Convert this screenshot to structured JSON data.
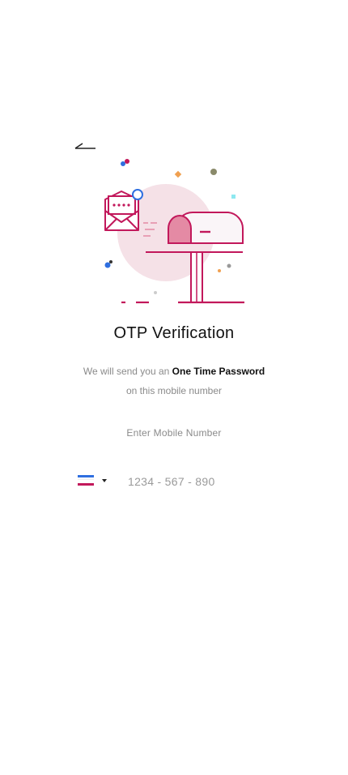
{
  "header": {
    "back_icon": "arrow-left-icon"
  },
  "illustration": {
    "icon": "mailbox-envelope-illustration",
    "colors": {
      "primary": "#c2185b",
      "circle": "#f5e1e7",
      "pink_fill": "#e48aa4"
    }
  },
  "title": "OTP Verification",
  "subtitle": {
    "prefix": "We will send you an ",
    "emphasis": "One Time Password",
    "line2": "on this mobile number"
  },
  "phone": {
    "label": "Enter Mobile Number",
    "placeholder": "1234 - 567 - 890",
    "value": "",
    "country_flag_icon": "flag-icon",
    "dropdown_icon": "caret-down-icon"
  }
}
